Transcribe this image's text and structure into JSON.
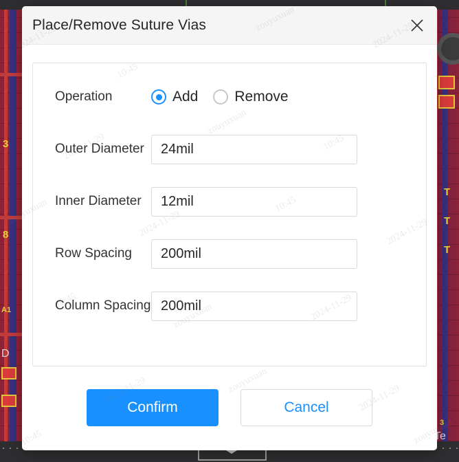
{
  "dialog": {
    "title": "Place/Remove Suture Vias",
    "close_icon": "close-icon",
    "accent_color": "#1890ff",
    "titlebar_bg": "#f5f5f5",
    "fields": [
      {
        "key": "operation",
        "label": "Operation",
        "type": "radio",
        "options": [
          {
            "label": "Add",
            "checked": true
          },
          {
            "label": "Remove",
            "checked": false
          }
        ]
      },
      {
        "key": "outer_diameter",
        "label": "Outer Diameter",
        "type": "text",
        "value": "24mil",
        "placeholder": ""
      },
      {
        "key": "inner_diameter",
        "label": "Inner Diameter",
        "type": "text",
        "value": "12mil",
        "placeholder": ""
      },
      {
        "key": "row_spacing",
        "label": "Row Spacing",
        "type": "text",
        "value": "200mil",
        "placeholder": ""
      },
      {
        "key": "column_spacing",
        "label": "Column Spacing",
        "type": "text",
        "value": "200mil",
        "placeholder": ""
      }
    ],
    "footer": {
      "confirm_label": "Confirm",
      "cancel_label": "Cancel"
    }
  },
  "background": {
    "app_kind": "pcb-layout-editor",
    "silkscreen_labels": [
      "3",
      "8",
      "A1",
      "T",
      "D"
    ],
    "status_text": "Te"
  },
  "watermarks": {
    "date": "2024-11-29",
    "time": "10:45",
    "user": "zouyuxuan"
  }
}
